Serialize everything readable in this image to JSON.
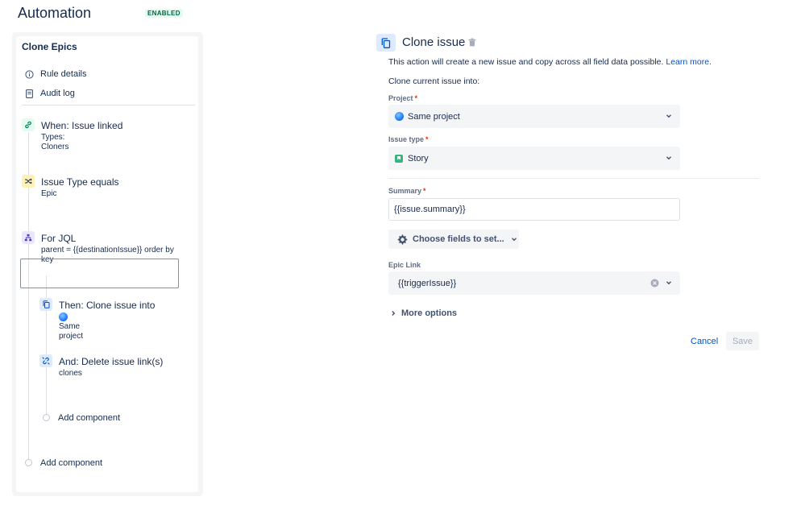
{
  "header": {
    "title": "Automation",
    "status_badge": "ENABLED"
  },
  "sidebar": {
    "rule_name": "Clone Epics",
    "links": [
      {
        "label": "Rule details",
        "icon": "info-icon"
      },
      {
        "label": "Audit log",
        "icon": "document-icon"
      }
    ],
    "components": [
      {
        "title": "When: Issue linked",
        "subtitle": "Types: Cloners",
        "icon": "link-icon",
        "icon_bg": "#e3fcef",
        "icon_color": "#00875a"
      },
      {
        "title": "Issue Type equals",
        "subtitle": "Epic",
        "icon": "shuffle-icon",
        "icon_bg": "#fff0b3",
        "icon_color": "#172b4d"
      },
      {
        "title": "For JQL",
        "subtitle": "parent = {{destinationIssue}} order by key",
        "icon": "hierarchy-icon",
        "icon_bg": "#eae6ff",
        "icon_color": "#5243aa"
      },
      {
        "title": "Then: Clone issue into",
        "subtitle": "Same project",
        "icon": "copy-icon",
        "icon_bg": "#deebff",
        "icon_color": "#0052cc"
      },
      {
        "title": "And: Delete issue link(s)",
        "subtitle": "clones",
        "icon": "unlink-icon",
        "icon_bg": "#deebff",
        "icon_color": "#0052cc"
      }
    ],
    "add_component_nested": "Add component",
    "add_component_root": "Add component"
  },
  "panel": {
    "title": "Clone issue",
    "description": "This action will create a new issue and copy across all field data possible.",
    "learn_more": "Learn more.",
    "clone_into_label": "Clone current issue into:",
    "project": {
      "label": "Project",
      "required_mark": "*",
      "value": "Same project"
    },
    "issue_type": {
      "label": "Issue type",
      "required_mark": "*",
      "value": "Story"
    },
    "summary": {
      "label": "Summary",
      "required_mark": "*",
      "value": "{{issue.summary}}"
    },
    "choose_fields": "Choose fields to set...",
    "epic_link": {
      "label": "Epic Link",
      "value": "{{triggerIssue}}"
    },
    "more_options": "More options",
    "cancel": "Cancel",
    "save": "Save"
  },
  "colors": {
    "accent": "#0052cc",
    "selected_border": "#4c9aff",
    "enabled_badge": "#006644"
  }
}
